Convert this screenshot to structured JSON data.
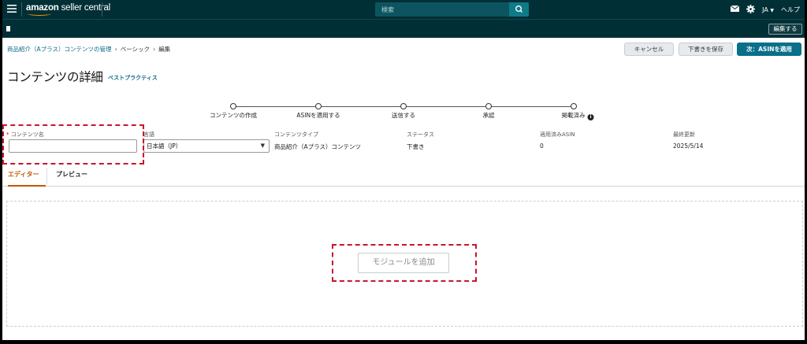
{
  "topbar": {
    "logo_brand": "amazon",
    "logo_product": "seller central",
    "search_placeholder": "検索",
    "lang": "JA",
    "help": "ヘルプ"
  },
  "subbar": {
    "edit_label": "編集する"
  },
  "breadcrumb": {
    "items": [
      "商品紹介（Aプラス）コンテンツの管理",
      "ベーシック",
      "編集"
    ]
  },
  "actions": {
    "cancel": "キャンセル",
    "save_draft": "下書きを保存",
    "next": "次：ASINを適用"
  },
  "page": {
    "title": "コンテンツの詳細",
    "best_practice": "ベストプラクティス"
  },
  "stepper": {
    "steps": [
      "コンテンツの作成",
      "ASINを適用する",
      "送信する",
      "承認",
      "掲載済み"
    ]
  },
  "fields": {
    "content_name_label": "コンテンツ名",
    "content_name_value": "",
    "language_label": "言語",
    "language_value": "日本語（JP）",
    "content_type_label": "コンテンツタイプ",
    "content_type_value": "商品紹介（Aプラス）コンテンツ",
    "status_label": "ステータス",
    "status_value": "下書き",
    "applied_asin_label": "適用済みASIN",
    "applied_asin_value": "0",
    "last_updated_label": "最終更新",
    "last_updated_value": "2025/5/14"
  },
  "tabs": {
    "editor": "エディター",
    "preview": "プレビュー"
  },
  "editor": {
    "add_module": "モジュールを追加"
  },
  "colors": {
    "topbar_bg": "#002f36",
    "primary_button": "#08708a",
    "active_tab": "#c45500",
    "annotation_red": "#c9162b"
  }
}
